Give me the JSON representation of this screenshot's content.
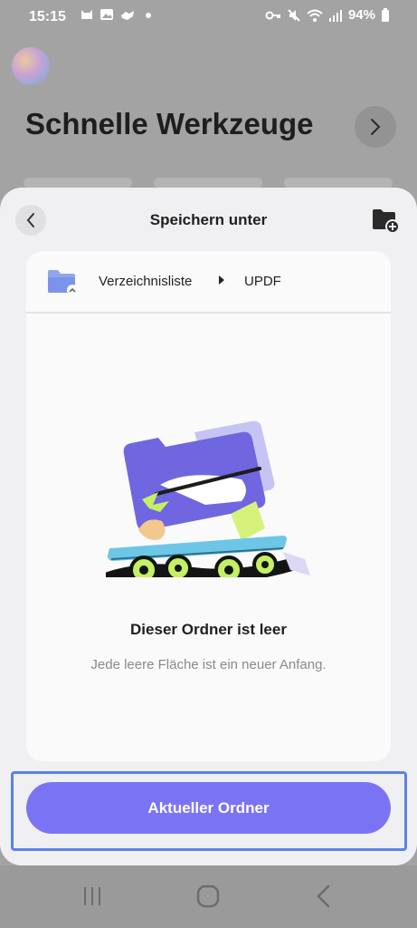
{
  "status_bar": {
    "time": "15:15",
    "battery": "94%",
    "left_icons": [
      "cat-icon",
      "image-icon",
      "hand-icon",
      "dot-icon"
    ],
    "right_icons": [
      "key-icon",
      "mute-icon",
      "wifi-icon",
      "signal-icon",
      "battery-icon"
    ]
  },
  "background": {
    "title": "Schnelle Werkzeuge"
  },
  "sheet": {
    "title": "Speichern unter",
    "breadcrumb": {
      "root": "Verzeichnisliste",
      "current": "UPDF"
    },
    "empty_state": {
      "title": "Dieser Ordner ist leer",
      "subtitle": "Jede leere Fläche ist ein neuer Anfang."
    },
    "primary_button": "Aktueller Ordner"
  },
  "colors": {
    "accent": "#7a74f5",
    "focus": "#5b83e6",
    "sheet_bg": "#f0f0f2",
    "card_bg": "#fafafa"
  }
}
